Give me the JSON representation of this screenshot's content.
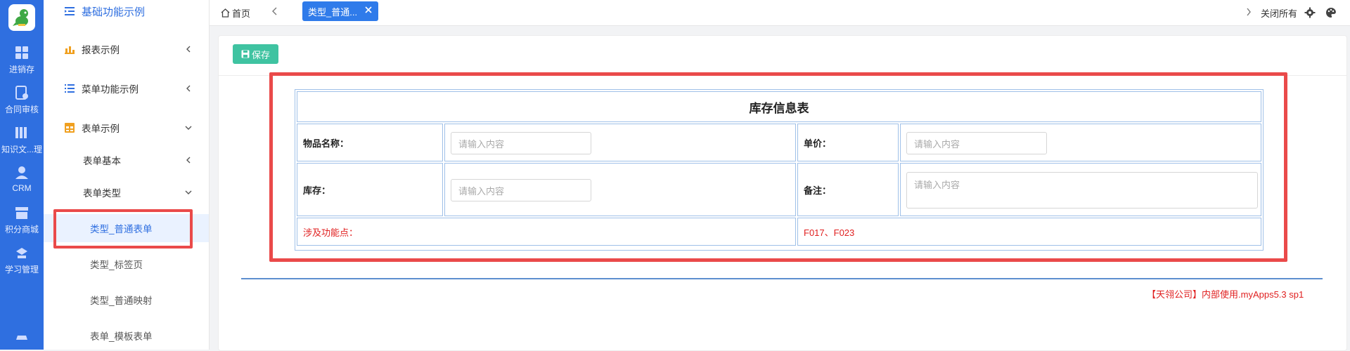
{
  "rail": {
    "items": [
      {
        "label": "进销存",
        "icon": "grid-icon"
      },
      {
        "label": "合同审核",
        "icon": "contract-icon"
      },
      {
        "label": "知识文...理",
        "icon": "books-icon"
      },
      {
        "label": "CRM",
        "icon": "user-icon"
      },
      {
        "label": "积分商城",
        "icon": "store-icon"
      },
      {
        "label": "学习管理",
        "icon": "study-icon"
      }
    ]
  },
  "sidebar": {
    "title": "基础功能示例",
    "items": [
      {
        "label": "报表示例"
      },
      {
        "label": "菜单功能示例"
      },
      {
        "label": "表单示例"
      },
      {
        "label": "表单基本"
      },
      {
        "label": "表单类型"
      },
      {
        "label": "类型_普通表单"
      },
      {
        "label": "类型_标签页"
      },
      {
        "label": "类型_普通映射"
      },
      {
        "label": "表单_模板表单"
      }
    ]
  },
  "topbar": {
    "home": "首页",
    "active_tab": "类型_普通...",
    "close_all": "关闭所有"
  },
  "toolbar": {
    "save_label": "保存"
  },
  "form": {
    "title": "库存信息表",
    "name_label": "物品名称：",
    "price_label": "单价：",
    "stock_label": "库存：",
    "remark_label": "备注：",
    "placeholder": "请输入内容",
    "feature_label": "涉及功能点：",
    "feature_value": "F017、F023"
  },
  "footer": {
    "text": "【天翎公司】内部使用.myApps5.3 sp1"
  },
  "colors": {
    "accent": "#2f6fe0",
    "save": "#3fc3a1",
    "highlight": "#ea4a4a",
    "feature": "#e02020"
  }
}
